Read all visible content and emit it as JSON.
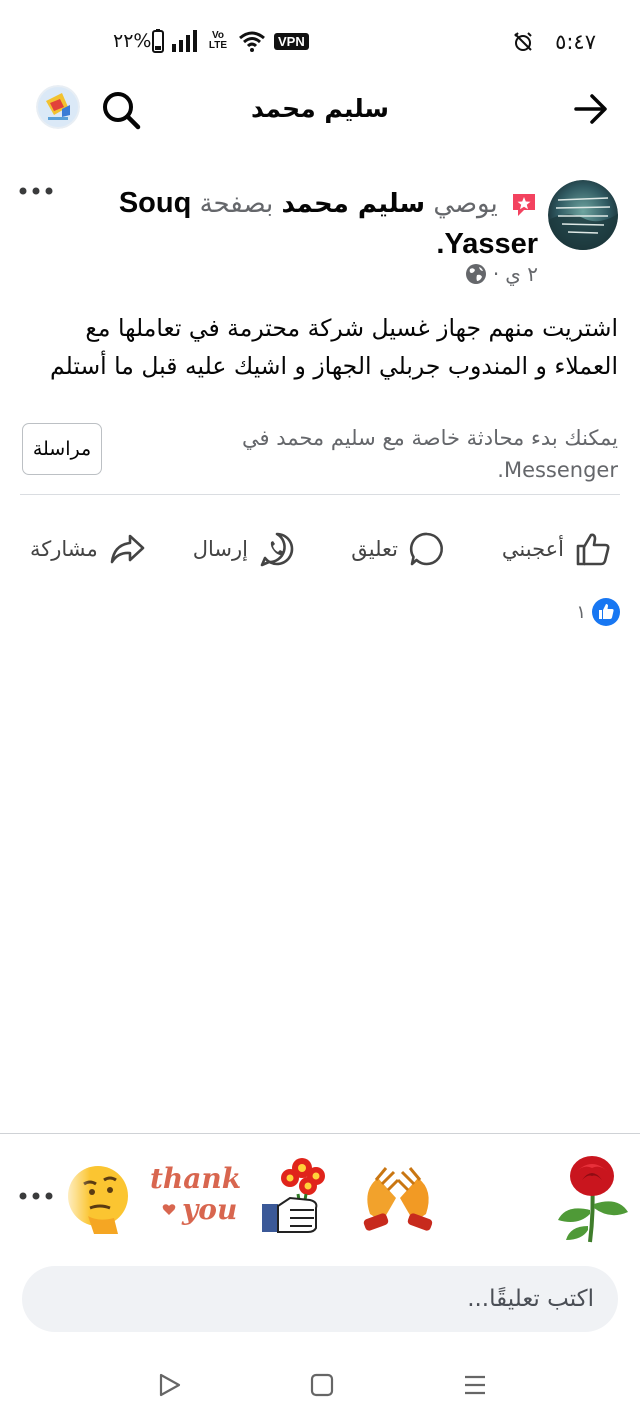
{
  "status_bar": {
    "time": "٥:٤٧",
    "battery_percent": "%٢٢",
    "vpn_label": "VPN",
    "volte_label": "Vo LTE"
  },
  "header": {
    "title": "سليم محمد",
    "back_icon": "arrow-right-icon",
    "search_icon": "search-icon"
  },
  "post": {
    "recommend_word": "يوصي",
    "author_name": "سليم محمد",
    "page_word": "بصفحة",
    "page_name": "Souq Yasser",
    "page_name_suffix": ".",
    "time": "٢ ي",
    "time_separator": "·",
    "text": "اشتريت منهم جهاز غسيل شركة محترمة في تعاملها مع العملاء و المندوب جربلي الجهاز و اشيك عليه قبل ما أستلم"
  },
  "messenger_prompt": {
    "text": "يمكنك بدء محادثة خاصة مع سليم محمد في Messenger.",
    "button_label": "مراسلة"
  },
  "actions": {
    "like": "أعجبني",
    "comment": "تعليق",
    "send": "إرسال",
    "share": "مشاركة"
  },
  "reactions": {
    "count": "١"
  },
  "stickers": {
    "thank_you_line1": "thank",
    "thank_you_line2": "you"
  },
  "comment_box": {
    "placeholder": "اكتب تعليقًا..."
  },
  "colors": {
    "facebook_blue": "#1877f2",
    "text_primary": "#050505",
    "text_secondary": "#65676b",
    "star_badge": "#f3425f"
  }
}
